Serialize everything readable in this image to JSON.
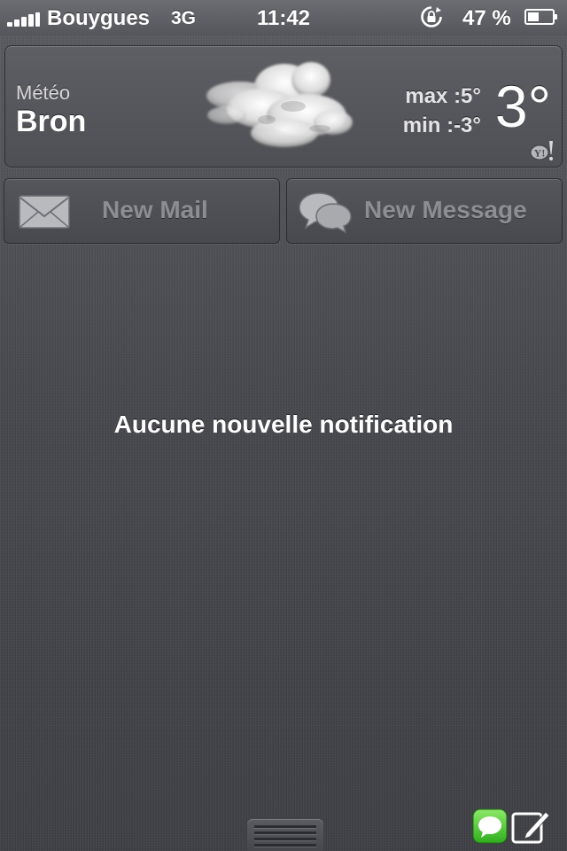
{
  "status_bar": {
    "carrier": "Bouygues",
    "network": "3G",
    "time": "11:42",
    "battery_percent": "47 %",
    "battery_level": 0.47,
    "signal_bars": 5,
    "icons": [
      "signal-bars-icon",
      "rotation-lock-icon",
      "battery-icon"
    ]
  },
  "weather": {
    "app_name": "Météo",
    "city": "Bron",
    "max": "max :5°",
    "min": "min :-3°",
    "current": "3°",
    "condition_icon": "cloud-icon",
    "provider_icon": "yahoo-icon"
  },
  "share": {
    "mail_label": "New Mail",
    "message_label": "New Message",
    "mail_icon": "envelope-icon",
    "message_icon": "chat-bubbles-icon"
  },
  "notifications": {
    "empty_text": "Aucune nouvelle notification"
  },
  "bottom": {
    "icons": [
      "grabber-handle-icon",
      "messages-app-icon",
      "compose-icon"
    ]
  },
  "colors": {
    "background": "#4b4c51",
    "messages_green": "#4cd137"
  }
}
